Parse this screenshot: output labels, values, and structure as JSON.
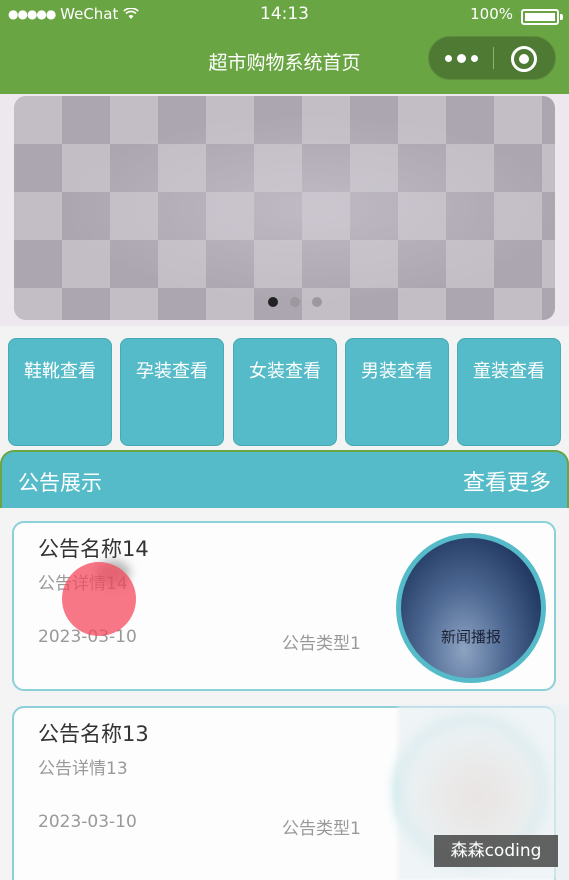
{
  "status_bar": {
    "signal": "●●●●●",
    "carrier": "WeChat",
    "time": "14:13",
    "battery": "100%"
  },
  "nav": {
    "title": "超市购物系统首页"
  },
  "banner": {
    "slide_count": 3,
    "active_index": 0
  },
  "categories": [
    {
      "label": "鞋靴查看"
    },
    {
      "label": "孕装查看"
    },
    {
      "label": "女装查看"
    },
    {
      "label": "男装查看"
    },
    {
      "label": "童装查看"
    }
  ],
  "notices_section": {
    "title": "公告展示",
    "more": "查看更多"
  },
  "notices": [
    {
      "name": "公告名称14",
      "detail": "公告详情14",
      "date": "2023-03-10",
      "type": "公告类型1",
      "image_caption": "新闻播报"
    },
    {
      "name": "公告名称13",
      "detail": "公告详情13",
      "date": "2023-03-10",
      "type": "公告类型1",
      "image_caption": ""
    }
  ],
  "watermark": "森森coding",
  "colors": {
    "header_green": "#6aa544",
    "accent_teal": "#55bbc8",
    "card_border": "#8bd0d8"
  }
}
